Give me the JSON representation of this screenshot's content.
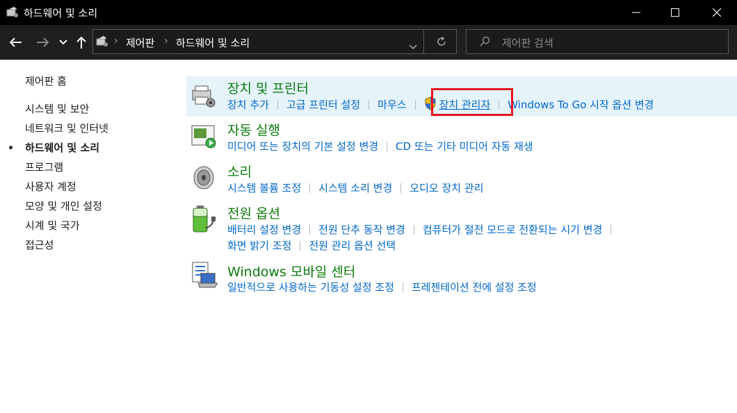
{
  "window": {
    "title": "하드웨어 및 소리"
  },
  "address": {
    "crumbs": [
      "제어판",
      "하드웨어 및 소리"
    ]
  },
  "search": {
    "placeholder": "제어판 검색"
  },
  "sidebar": {
    "home": "제어판 홈",
    "items": [
      {
        "label": "시스템 및 보안",
        "current": false
      },
      {
        "label": "네트워크 및 인터넷",
        "current": false
      },
      {
        "label": "하드웨어 및 소리",
        "current": true
      },
      {
        "label": "프로그램",
        "current": false
      },
      {
        "label": "사용자 계정",
        "current": false
      },
      {
        "label": "모양 및 개인 설정",
        "current": false
      },
      {
        "label": "시계 및 국가",
        "current": false
      },
      {
        "label": "접근성",
        "current": false
      }
    ]
  },
  "categories": [
    {
      "title": "장치 및 프린터",
      "icon": "devices-printers-icon",
      "links": [
        "장치 추가",
        "고급 프린터 설정",
        "마우스",
        "장치 관리자",
        "Windows To Go 시작 옵션 변경"
      ]
    },
    {
      "title": "자동 실행",
      "icon": "autoplay-icon",
      "links": [
        "미디어 또는 장치의 기본 설정 변경",
        "CD 또는 기타 미디어 자동 재생"
      ]
    },
    {
      "title": "소리",
      "icon": "speaker-icon",
      "links": [
        "시스템 볼륨 조정",
        "시스템 소리 변경",
        "오디오 장치 관리"
      ]
    },
    {
      "title": "전원 옵션",
      "icon": "battery-icon",
      "links": [
        "배터리 설정 변경",
        "전원 단추 동작 변경",
        "컴퓨터가 절전 모드로 전환되는 시기 변경"
      ],
      "links2": [
        "화면 밝기 조정",
        "전원 관리 옵션 선택"
      ]
    },
    {
      "title": "Windows 모바일 센터",
      "icon": "mobility-center-icon",
      "links": [
        "일반적으로 사용하는 기동성 설정 조정",
        "프레젠테이션 전에 설정 조정"
      ]
    }
  ]
}
